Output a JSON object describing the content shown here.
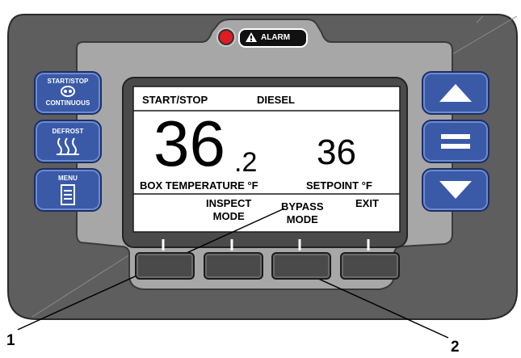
{
  "alarm": {
    "label": "ALARM",
    "indicator_color": "#e01b24"
  },
  "left_buttons": [
    {
      "line1": "START/STOP",
      "line2": "CONTINUOUS",
      "icon": "continuous-icon"
    },
    {
      "line1": "DEFROST",
      "icon": "defrost-icon"
    },
    {
      "line1": "MENU",
      "icon": "menu-icon"
    }
  ],
  "right_buttons": [
    {
      "icon": "up-arrow-icon"
    },
    {
      "icon": "equals-icon"
    },
    {
      "icon": "down-arrow-icon"
    }
  ],
  "display": {
    "status_mode": "START/STOP",
    "status_engine": "DIESEL",
    "box_temp_whole": "36",
    "box_temp_decimal": ".2",
    "box_temp_label": "BOX TEMPERATURE °F",
    "setpoint_value": "36",
    "setpoint_label": "SETPOINT °F",
    "softkeys": [
      {
        "line1": "",
        "line2": ""
      },
      {
        "line1": "INSPECT",
        "line2": "MODE"
      },
      {
        "line1": "BYPASS",
        "line2": "MODE"
      },
      {
        "line1": "EXIT",
        "line2": ""
      }
    ]
  },
  "callouts": [
    "1",
    "2"
  ],
  "colors": {
    "button_blue": "#3a5aa8",
    "bezel": "#5c5c5c",
    "panel": "#a9a9a9"
  }
}
